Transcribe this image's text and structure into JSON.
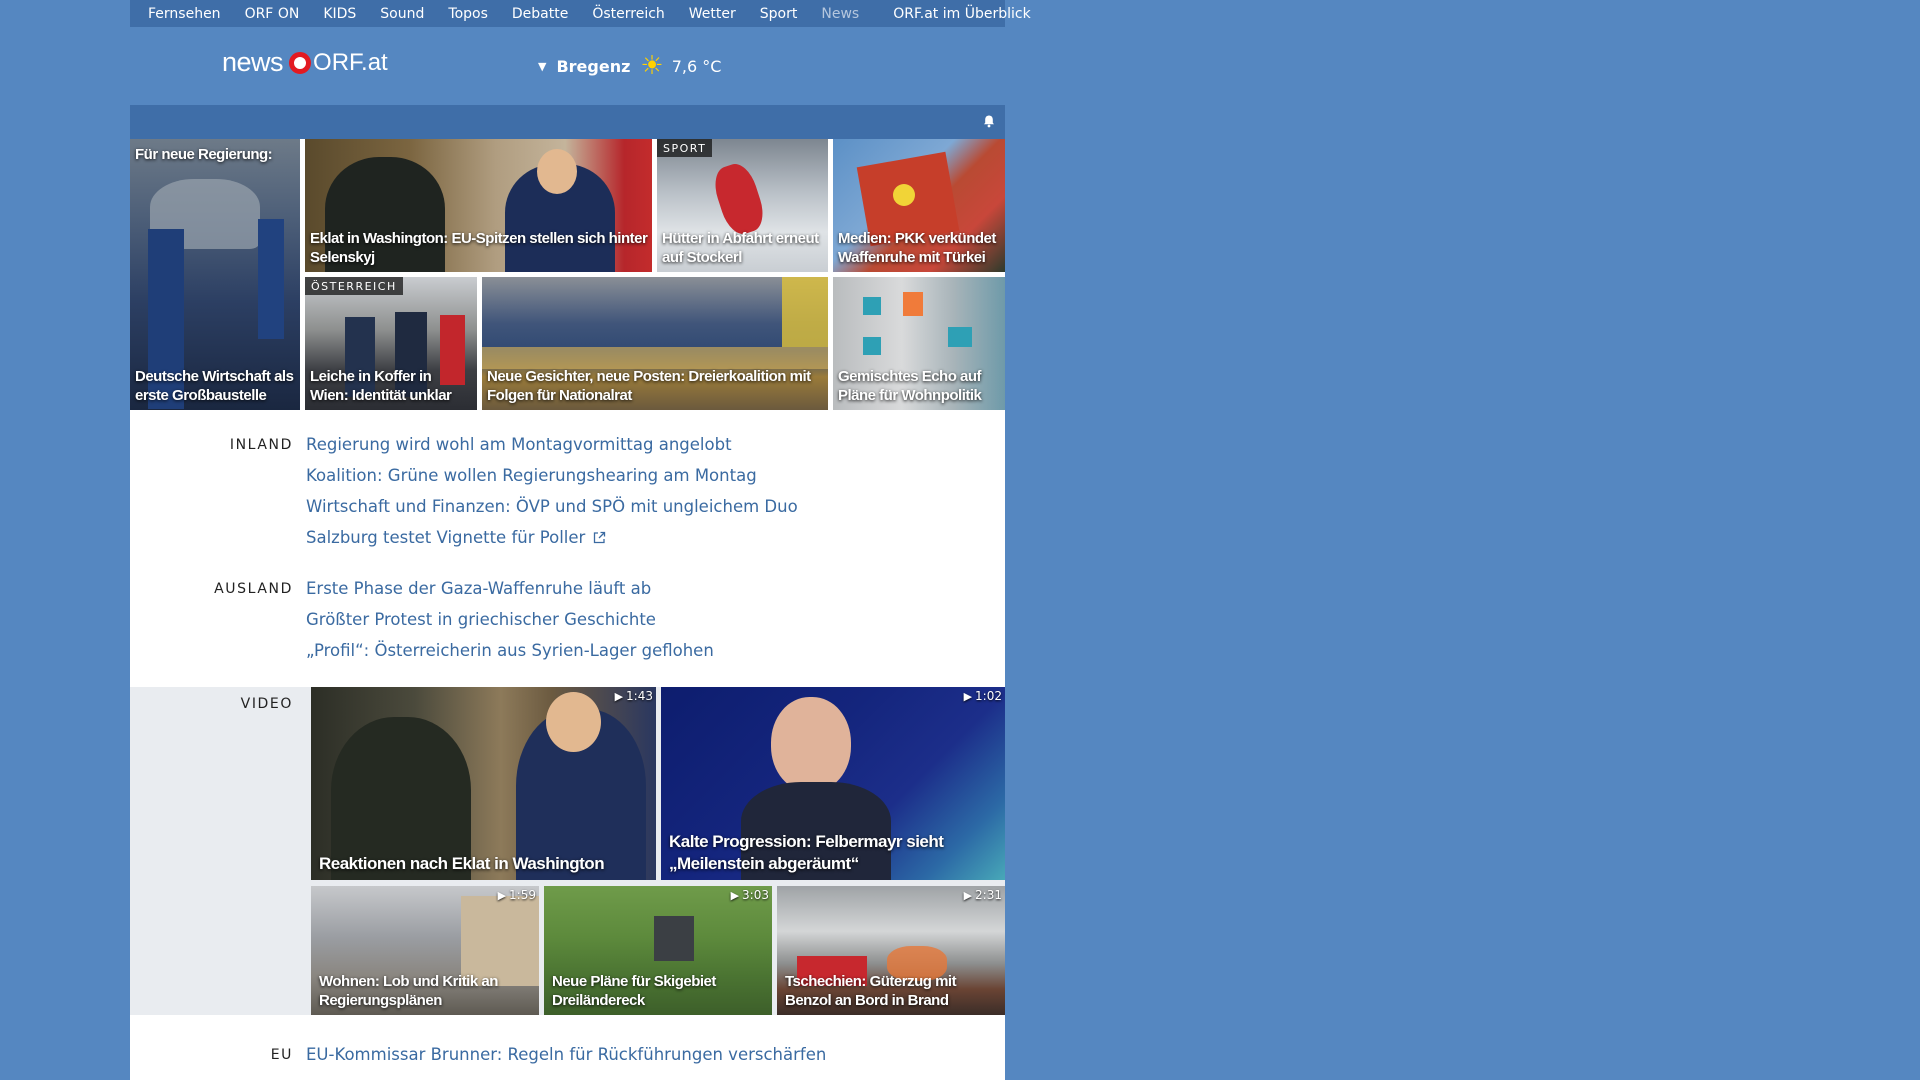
{
  "topnav": {
    "items": [
      "Fernsehen",
      "ORF ON",
      "KIDS",
      "Sound",
      "Topos",
      "Debatte",
      "Österreich",
      "Wetter",
      "Sport",
      "News"
    ],
    "overview": "ORF.at im Überblick"
  },
  "logo": {
    "news": "news",
    "orf": "ORF.at"
  },
  "weather": {
    "city": "Bregenz",
    "icon": "sun-icon",
    "temp": "7,6 °C"
  },
  "tiles": {
    "t1": {
      "top": "Für neue Regierung:",
      "caption": "Deutsche Wirtschaft als erste Großbaustelle"
    },
    "t2": {
      "caption": "Eklat in Washington: EU-Spitzen stellen sich hinter Selenskyj"
    },
    "t3": {
      "tag": "SPORT",
      "caption": "Hütter in Abfahrt erneut auf Stockerl"
    },
    "t4": {
      "caption": "Medien: PKK verkündet Waffenruhe mit Türkei"
    },
    "t5": {
      "tag": "ÖSTERREICH",
      "caption": "Leiche in Koffer in Wien: Identität unklar"
    },
    "t6": {
      "caption": "Neue Gesichter, neue Posten: Dreierkoalition mit Folgen für Nationalrat"
    },
    "t7": {
      "caption": "Gemischtes Echo auf Pläne für Wohnpolitik"
    }
  },
  "inland": {
    "label": "INLAND",
    "links": [
      "Regierung wird wohl am Montagvormittag angelobt",
      "Koalition: Grüne wollen Regierungshearing am Montag",
      "Wirtschaft und Finanzen: ÖVP und SPÖ mit ungleichem Duo",
      "Salzburg testet Vignette für Poller"
    ]
  },
  "ausland": {
    "label": "AUSLAND",
    "links": [
      "Erste Phase der Gaza-Waffenruhe läuft ab",
      "Größter Protest in griechischer Geschichte",
      "„Profil“: Österreicherin aus Syrien-Lager geflohen"
    ]
  },
  "video": {
    "label": "VIDEO",
    "v1": {
      "duration": "1:43",
      "caption": "Reaktionen nach Eklat in Washington"
    },
    "v2": {
      "duration": "1:02",
      "caption": "Kalte Progression: Felbermayr sieht „Meilenstein abgeräumt“"
    },
    "v3": {
      "duration": "1:59",
      "caption": "Wohnen: Lob und Kritik an Regierungsplänen"
    },
    "v4": {
      "duration": "3:03",
      "caption": "Neue Pläne für Skigebiet Dreiländereck"
    },
    "v5": {
      "duration": "2:31",
      "caption": "Tschechien: Güterzug mit Benzol an Bord in Brand"
    }
  },
  "eu": {
    "label": "EU",
    "links": [
      "EU-Kommissar Brunner: Regeln für Rückführungen verschärfen"
    ]
  }
}
